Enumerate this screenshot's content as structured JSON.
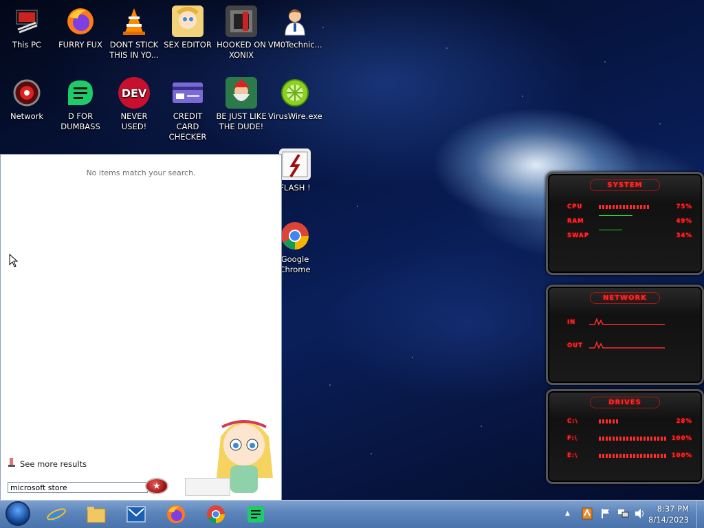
{
  "desktop": {
    "icons": [
      {
        "label": "This PC"
      },
      {
        "label": "FURRY FUX"
      },
      {
        "label": "DONT STICK THIS IN YO..."
      },
      {
        "label": "SEX EDITOR"
      },
      {
        "label": "HOOKED ON XONIX"
      },
      {
        "label": "VM0Technic..."
      },
      {
        "label": "Network"
      },
      {
        "label": "D FOR DUMBASS"
      },
      {
        "label": "NEVER USED!"
      },
      {
        "label": "CREDIT CARD CHECKER"
      },
      {
        "label": "BE JUST LIKE THE DUDE!"
      },
      {
        "label": "VirusWire.exe"
      },
      {
        "label": "FLASH !"
      },
      {
        "label": "Google Chrome"
      }
    ],
    "dev_icon_text": "DEV"
  },
  "start_menu": {
    "no_items_text": "No items match your search.",
    "see_more_label": "See more results",
    "search_value": "microsoft store"
  },
  "gadgets": {
    "system": {
      "title": "SYSTEM",
      "rows": [
        {
          "label": "CPU",
          "value": "75%",
          "fill": 0.75
        },
        {
          "label": "RAM",
          "value": "49%",
          "fill": 0.49
        },
        {
          "label": "SWAP",
          "value": "34%",
          "fill": 0.34
        }
      ]
    },
    "network": {
      "title": "NETWORK",
      "rows": [
        {
          "label": "IN"
        },
        {
          "label": "OUT"
        }
      ]
    },
    "drives": {
      "title": "DRIVES",
      "rows": [
        {
          "label": "C:\\",
          "value": "28%",
          "fill": 0.28
        },
        {
          "label": "F:\\",
          "value": "100%",
          "fill": 1.0
        },
        {
          "label": "E:\\",
          "value": "100%",
          "fill": 1.0
        }
      ]
    }
  },
  "taskbar": {
    "pinned": [
      "internet-explorer-icon",
      "file-explorer-icon",
      "mail-icon",
      "firefox-icon",
      "chrome-icon",
      "notes-icon"
    ],
    "clock_time": "8:37 PM",
    "clock_date": "8/14/2023"
  },
  "colors": {
    "accent_red": "#ff2a2a",
    "taskbar": "#5b84bb"
  }
}
